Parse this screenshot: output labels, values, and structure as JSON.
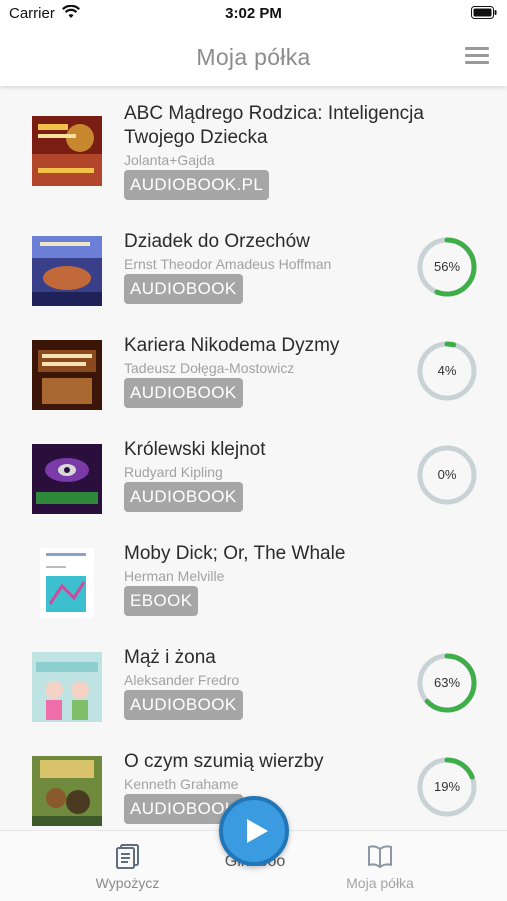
{
  "status_bar": {
    "carrier": "Carrier",
    "time": "3:02 PM"
  },
  "header": {
    "title": "Moja półka"
  },
  "books": [
    {
      "title": "ABC Mądrego Rodzica: Inteligencja Twojego Dziecka",
      "author": "Jolanta+Gajda",
      "format": "AUDIOBOOK.PL",
      "progress": null
    },
    {
      "title": "Dziadek do Orzechów",
      "author": "Ernst Theodor Amadeus Hoffman",
      "format": "AUDIOBOOK",
      "progress": 56,
      "progress_label": "56%"
    },
    {
      "title": "Kariera Nikodema Dyzmy",
      "author": "Tadeusz Dołęga-Mostowicz",
      "format": "AUDIOBOOK",
      "progress": 4,
      "progress_label": "4%"
    },
    {
      "title": "Królewski klejnot",
      "author": "Rudyard Kipling",
      "format": "AUDIOBOOK",
      "progress": 0,
      "progress_label": "0%"
    },
    {
      "title": "Moby Dick; Or, The Whale",
      "author": "Herman Melville",
      "format": "EBOOK",
      "progress": null
    },
    {
      "title": "Mąż i żona",
      "author": "Aleksander Fredro",
      "format": "AUDIOBOOK",
      "progress": 63,
      "progress_label": "63%"
    },
    {
      "title": "O czym szumią wierzby",
      "author": "Kenneth Grahame",
      "format": "AUDIOBOOK",
      "progress": 19,
      "progress_label": "19%"
    }
  ],
  "tabbar": {
    "left": {
      "label": "Wypożycz",
      "icon": "books-icon"
    },
    "center": {
      "label": "Ginaboo",
      "icon": "play-icon"
    },
    "right": {
      "label": "Moja półka",
      "icon": "open-book-icon"
    }
  },
  "colors": {
    "progress_done": "#3fae49",
    "progress_track": "#c9d3d6",
    "badge": "#a6a6a6",
    "play": "#3a9be0"
  }
}
